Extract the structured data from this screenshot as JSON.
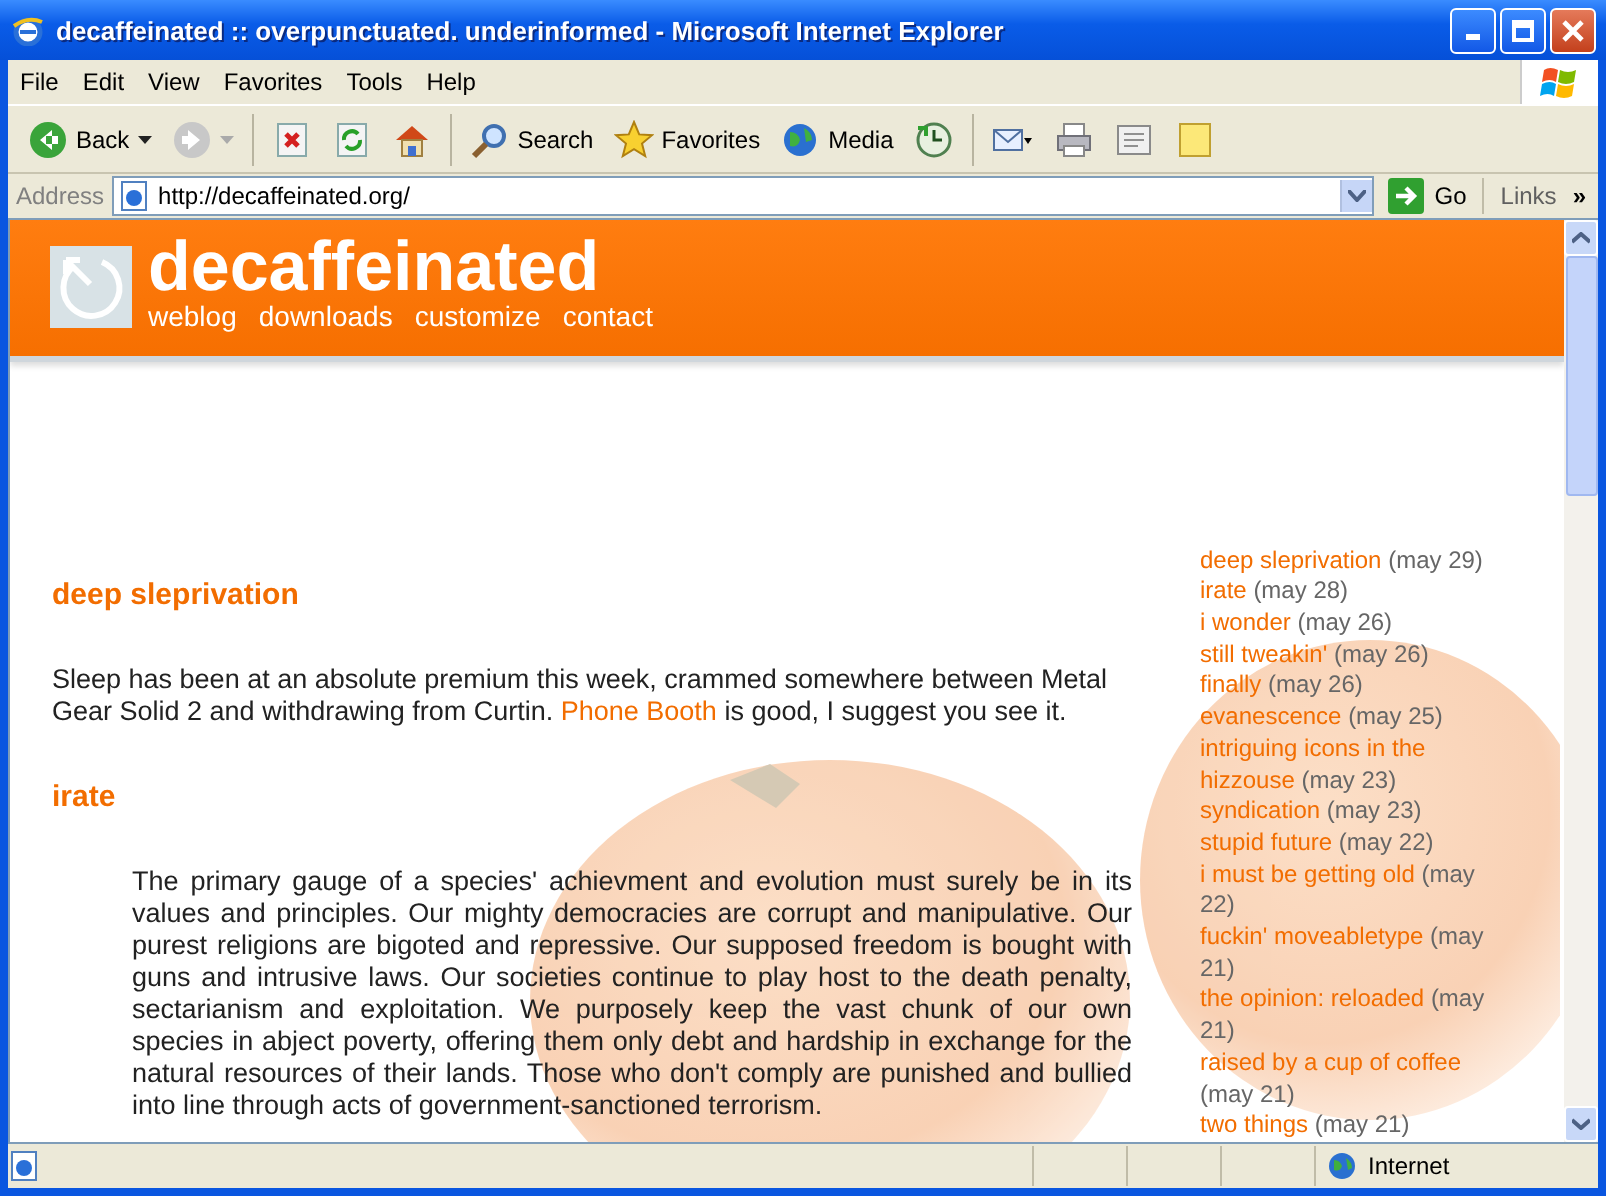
{
  "window": {
    "title": "decaffeinated :: overpunctuated. underinformed - Microsoft Internet Explorer"
  },
  "menu": [
    "File",
    "Edit",
    "View",
    "Favorites",
    "Tools",
    "Help"
  ],
  "toolbar": [
    {
      "kind": "back",
      "label": "Back"
    },
    {
      "kind": "forward"
    },
    {
      "kind": "sep"
    },
    {
      "kind": "stop"
    },
    {
      "kind": "refresh"
    },
    {
      "kind": "home"
    },
    {
      "kind": "sep"
    },
    {
      "kind": "search",
      "label": "Search"
    },
    {
      "kind": "favorites",
      "label": "Favorites"
    },
    {
      "kind": "media",
      "label": "Media"
    },
    {
      "kind": "history"
    },
    {
      "kind": "sep"
    },
    {
      "kind": "mail"
    },
    {
      "kind": "print"
    },
    {
      "kind": "edit"
    },
    {
      "kind": "note"
    }
  ],
  "address": {
    "label": "Address",
    "url": "http://decaffeinated.org/",
    "go": "Go",
    "links": "Links",
    "more": "»"
  },
  "site": {
    "title": "decaffeinated",
    "nav": [
      "weblog",
      "downloads",
      "customize",
      "contact"
    ],
    "posts": [
      {
        "title": "deep sleprivation",
        "kind": "plain",
        "body": [
          {
            "kind": "text",
            "text": "Sleep has been at an absolute premium this week, crammed somewhere between Metal Gear Solid 2 and withdrawing from Curtin. "
          },
          {
            "kind": "link",
            "text": "Phone Booth"
          },
          {
            "kind": "text",
            "text": " is good, I suggest you see it."
          }
        ]
      },
      {
        "title": "irate",
        "kind": "quote",
        "body": [
          {
            "kind": "text",
            "text": "The primary gauge of a species' achievment and evolution must surely be in its values and principles. Our mighty democracies are corrupt and manipulative. Our purest religions are bigoted and repressive. Our supposed freedom is bought with guns and intrusive laws. Our societies continue to play host to the death penalty, sectarianism and exploitation. We purposely keep the vast chunk of our own species in abject poverty, offering them only debt and hardship in exchange for the natural resources of their lands. Those who don't comply are punished and bullied into line through acts of government-sanctioned terrorism."
          }
        ]
      }
    ],
    "recent": [
      {
        "title": "deep sleprivation",
        "date": "(may 29)"
      },
      {
        "title": "irate",
        "date": "(may 28)"
      },
      {
        "title": "i wonder",
        "date": "(may 26)"
      },
      {
        "title": "still tweakin'",
        "date": "(may 26)"
      },
      {
        "title": "finally",
        "date": "(may 26)"
      },
      {
        "title": "evanescence",
        "date": "(may 25)"
      },
      {
        "title": "intriguing icons in the hizzouse",
        "date": "(may 23)"
      },
      {
        "title": "syndication",
        "date": "(may 23)"
      },
      {
        "title": "stupid future",
        "date": "(may 22)"
      },
      {
        "title": "i must be getting old",
        "date": "(may 22)"
      },
      {
        "title": "fuckin' moveabletype",
        "date": "(may 21)"
      },
      {
        "title": "the opinion: reloaded",
        "date": "(may 21)"
      },
      {
        "title": "raised by a cup of coffee",
        "date": "(may 21)"
      },
      {
        "title": "two things",
        "date": "(may 21)"
      }
    ]
  },
  "status_bar": {
    "zone": "Internet"
  }
}
